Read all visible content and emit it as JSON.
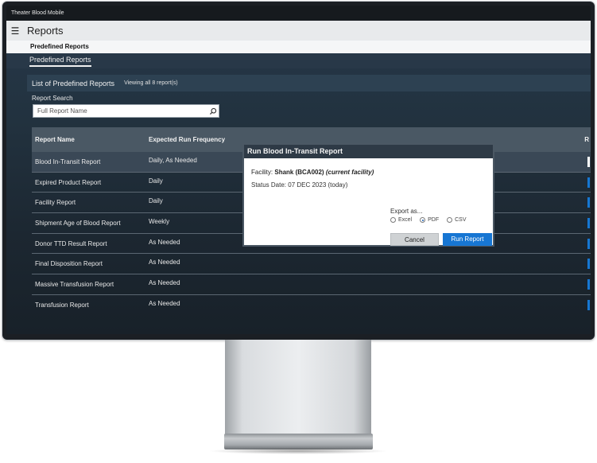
{
  "app": {
    "title": "Theater Blood Mobile"
  },
  "header": {
    "title": "Reports",
    "menu_icon": "hamburger-icon"
  },
  "subheader": {
    "title": "Predefined Reports"
  },
  "tabs": [
    {
      "label": "Predefined Reports",
      "active": true
    }
  ],
  "list": {
    "title": "List of Predefined Reports",
    "count_text": "Viewing all 8 report(s)"
  },
  "search": {
    "label": "Report Search",
    "placeholder": "Full Report Name",
    "value": "",
    "icon": "search-icon"
  },
  "table": {
    "columns": [
      "Report Name",
      "Expected Run Frequency",
      "R"
    ],
    "rows": [
      {
        "name": "Blood In-Transit Report",
        "frequency": "Daily, As Needed"
      },
      {
        "name": "Expired Product Report",
        "frequency": "Daily"
      },
      {
        "name": "Facility Report",
        "frequency": "Daily"
      },
      {
        "name": "Shipment Age of Blood Report",
        "frequency": "Weekly"
      },
      {
        "name": "Donor TTD Result Report",
        "frequency": "As Needed"
      },
      {
        "name": "Final Disposition Report",
        "frequency": "As Needed"
      },
      {
        "name": "Massive Transfusion Report",
        "frequency": "As Needed"
      },
      {
        "name": "Transfusion Report",
        "frequency": "As Needed"
      }
    ]
  },
  "modal": {
    "title": "Run Blood In-Transit Report",
    "facility_label": "Facility:",
    "facility_name": "Shank (BCA002)",
    "facility_note": "(current facility)",
    "status_date": "Status Date: 07 DEC 2023 (today)",
    "export_label": "Export as...",
    "export_options": [
      "Excel",
      "PDF",
      "CSV"
    ],
    "export_selected": "PDF",
    "cancel_label": "Cancel",
    "run_label": "Run Report"
  },
  "colors": {
    "accent": "#1776d3",
    "screen_bg": "#22323f",
    "header_bg": "#e8eaec"
  }
}
